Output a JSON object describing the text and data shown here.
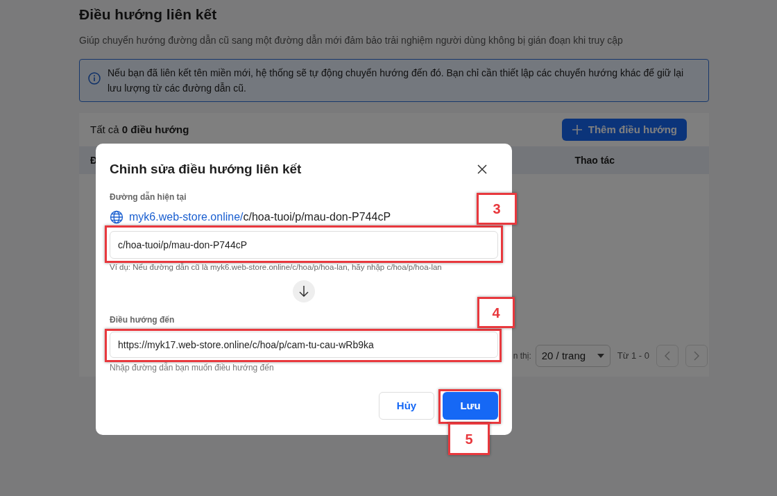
{
  "page": {
    "title": "Điều hướng liên kết",
    "subtitle": "Giúp chuyển hướng đường dẫn cũ sang một đường dẫn mới đảm bảo trải nghiệm người dùng không bị gián đoạn khi truy cập",
    "info": "Nếu bạn đã liên kết tên miền mới, hệ thống sẽ tự động chuyển hướng đến đó. Bạn chỉ cần thiết lập các chuyển hướng khác để giữ lại lưu lượng từ các đường dẫn cũ.",
    "count_prefix": "Tất cả",
    "count": "0 điều hướng",
    "add_button": "Thêm điều hướng",
    "columns": [
      "Đ",
      "Thao tác"
    ],
    "page_size_label": "n thị:",
    "page_size": "20 / trang",
    "range": "Từ 1 - 0"
  },
  "dialog": {
    "title": "Chỉnh sửa điều hướng liên kết",
    "current_label": "Đường dẫn hiện tại",
    "current_domain": "myk6.web-store.online/",
    "current_path": "c/hoa-tuoi/p/mau-don-P744cP",
    "source_value": "c/hoa-tuoi/p/mau-don-P744cP",
    "source_hint": "Ví dụ: Nếu đường dẫn cũ là myk6.web-store.online/c/hoa/p/hoa-lan, hãy nhập c/hoa/p/hoa-lan",
    "target_label": "Điều hướng đến",
    "target_value": "https://myk17.web-store.online/c/hoa/p/cam-tu-cau-wRb9ka",
    "target_hint": "Nhập đường dẫn bạn muốn điều hướng đến",
    "cancel": "Hủy",
    "save": "Lưu"
  },
  "annotations": [
    {
      "label": "3"
    },
    {
      "label": "4"
    },
    {
      "label": "5"
    }
  ]
}
